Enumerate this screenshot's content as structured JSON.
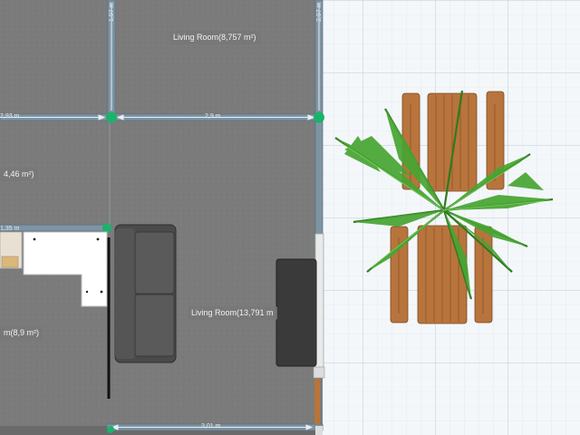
{
  "rooms": {
    "living_room_top": "Living Room(8,757 m²)",
    "living_room_main": "Living Room(13,791 m",
    "left_room_partial": "4,46 m²)",
    "bottom_left_room_partial": "m(8,9 m²)"
  },
  "dimensions": {
    "top_wall_horizontal": "2,9 m",
    "left_partial_horizontal": "2,93 m",
    "bottom_wall_horizontal": "3,01 m",
    "right_wall_vertical": "2,97 m",
    "left_wall_vertical": "1,97 m",
    "mid_left_horizontal": "1,35 m"
  },
  "colors": {
    "floor": "#7b7b7b",
    "wall": "#7e94a3",
    "outdoor_grid_bg": "#f4f7fa",
    "grid_line": "#cfd8e0",
    "handle": "#19b36b",
    "sofa": "#4a4a4a",
    "cabinet": "#3a3a3a",
    "wood": "#b8743c",
    "plant": "#3f9b2a"
  },
  "icons": {
    "sofa": "sofa-icon",
    "desk": "corner-desk-icon",
    "tv_cabinet": "tv-cabinet-icon",
    "picnic_table": "picnic-table-icon",
    "palm": "palm-plant-icon"
  }
}
